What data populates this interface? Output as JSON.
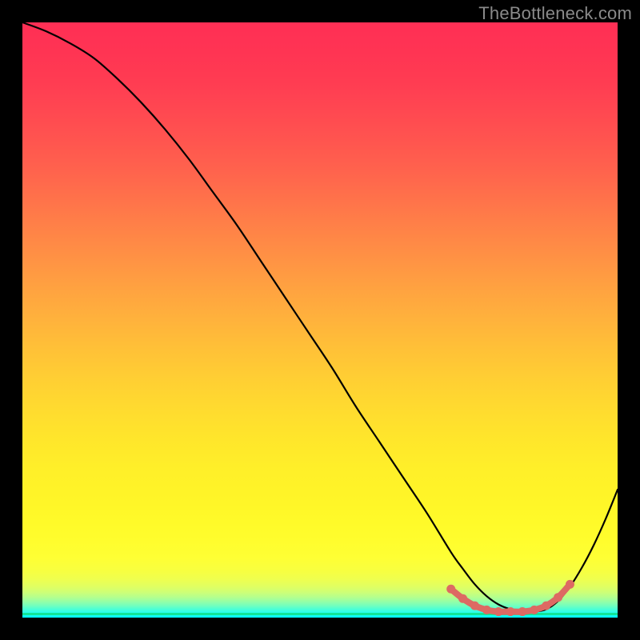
{
  "attribution": "TheBottleneck.com",
  "chart_data": {
    "type": "line",
    "title": "",
    "xlabel": "",
    "ylabel": "",
    "xlim": [
      0,
      100
    ],
    "ylim": [
      0,
      100
    ],
    "series": [
      {
        "name": "curve",
        "color": "#000000",
        "x": [
          0,
          4,
          8,
          12,
          16,
          20,
          24,
          28,
          32,
          36,
          40,
          44,
          48,
          52,
          56,
          60,
          64,
          68,
          72,
          74,
          76,
          78,
          80,
          82,
          84,
          86,
          88,
          90,
          92,
          94,
          96,
          98,
          100
        ],
        "y": [
          100,
          98.5,
          96.5,
          94.0,
          90.5,
          86.5,
          82.0,
          77.0,
          71.5,
          66.0,
          60.0,
          54.0,
          48.0,
          42.0,
          35.5,
          29.5,
          23.5,
          17.5,
          11.0,
          8.2,
          5.6,
          3.6,
          2.2,
          1.4,
          1.0,
          1.0,
          1.4,
          2.8,
          5.2,
          8.4,
          12.2,
          16.6,
          21.5
        ]
      },
      {
        "name": "optimal-range",
        "color": "#dd6a63",
        "x": [
          72,
          74,
          76,
          78,
          80,
          82,
          84,
          86,
          88,
          90,
          92
        ],
        "y": [
          4.8,
          3.2,
          2.0,
          1.3,
          1.0,
          1.0,
          1.0,
          1.3,
          2.0,
          3.4,
          5.6
        ]
      }
    ],
    "gradient_stops": [
      {
        "offset": 0.0,
        "color": "#ff2f55"
      },
      {
        "offset": 0.05,
        "color": "#ff3453"
      },
      {
        "offset": 0.1,
        "color": "#ff3c52"
      },
      {
        "offset": 0.15,
        "color": "#ff4851"
      },
      {
        "offset": 0.2,
        "color": "#ff554f"
      },
      {
        "offset": 0.25,
        "color": "#ff634d"
      },
      {
        "offset": 0.3,
        "color": "#ff734a"
      },
      {
        "offset": 0.35,
        "color": "#ff8347"
      },
      {
        "offset": 0.4,
        "color": "#ff9344"
      },
      {
        "offset": 0.45,
        "color": "#ffa340"
      },
      {
        "offset": 0.5,
        "color": "#ffb23c"
      },
      {
        "offset": 0.55,
        "color": "#ffc137"
      },
      {
        "offset": 0.6,
        "color": "#ffcf33"
      },
      {
        "offset": 0.65,
        "color": "#ffdb2f"
      },
      {
        "offset": 0.7,
        "color": "#ffe62b"
      },
      {
        "offset": 0.75,
        "color": "#ffef29"
      },
      {
        "offset": 0.8,
        "color": "#fff528"
      },
      {
        "offset": 0.84,
        "color": "#fffa29"
      },
      {
        "offset": 0.87,
        "color": "#fffd2d"
      },
      {
        "offset": 0.9,
        "color": "#feff34"
      },
      {
        "offset": 0.92,
        "color": "#f8ff3f"
      },
      {
        "offset": 0.935,
        "color": "#efff4e"
      },
      {
        "offset": 0.948,
        "color": "#e0ff62"
      },
      {
        "offset": 0.958,
        "color": "#ccff78"
      },
      {
        "offset": 0.966,
        "color": "#b3ff8f"
      },
      {
        "offset": 0.973,
        "color": "#95ffa6"
      },
      {
        "offset": 0.98,
        "color": "#72ffbe"
      },
      {
        "offset": 0.986,
        "color": "#4bffd6"
      },
      {
        "offset": 0.992,
        "color": "#24ffee"
      },
      {
        "offset": 1.0,
        "color": "#00ffff"
      }
    ],
    "bottom_line": {
      "y": 0.6,
      "color": "#12e597"
    }
  }
}
